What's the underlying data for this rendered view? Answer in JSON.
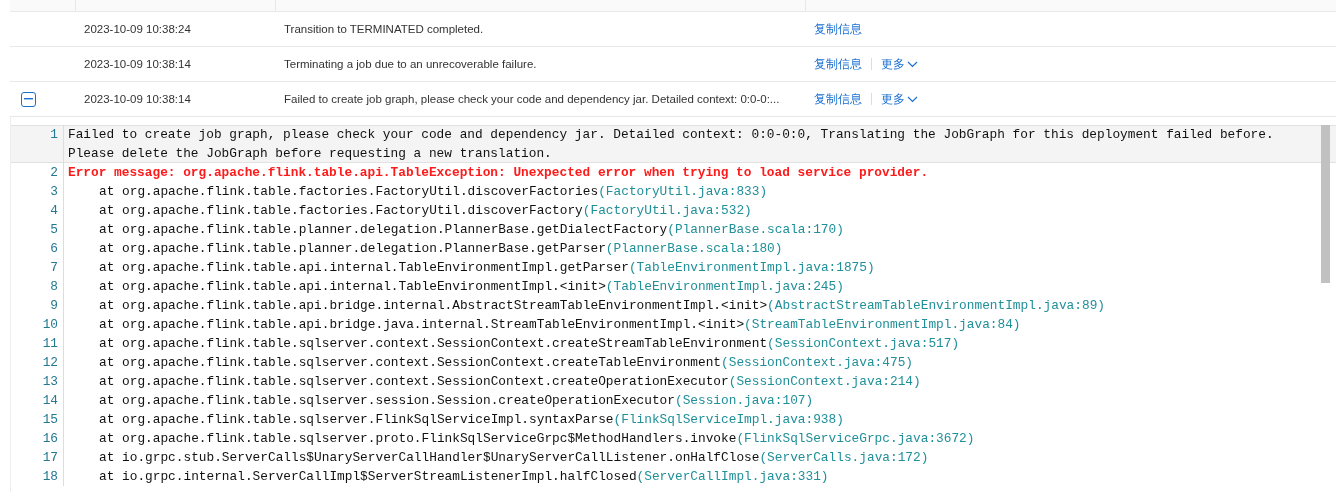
{
  "rows": [
    {
      "time": "2023-10-09 10:38:24",
      "message": "Transition to TERMINATED completed.",
      "expanded": false,
      "actions": [
        {
          "kind": "link",
          "label": "复制信息"
        }
      ]
    },
    {
      "time": "2023-10-09 10:38:14",
      "message": "Terminating a job due to an unrecoverable failure.",
      "expanded": false,
      "actions": [
        {
          "kind": "link",
          "label": "复制信息"
        },
        {
          "kind": "dropdown",
          "label": "更多"
        }
      ]
    },
    {
      "time": "2023-10-09 10:38:14",
      "message": "Failed to create job graph, please check your code and dependency jar. Detailed context: 0:0-0:...",
      "expanded": true,
      "actions": [
        {
          "kind": "link",
          "label": "复制信息"
        },
        {
          "kind": "dropdown",
          "label": "更多"
        }
      ]
    }
  ],
  "detail": {
    "lines": [
      {
        "number": "1",
        "kind": "plain",
        "text": "Failed to create job graph, please check your code and dependency jar. Detailed context: 0:0-0:0, Translating the JobGraph for this deployment failed before. Please delete the JobGraph before requesting a new translation.",
        "selected": true
      },
      {
        "number": "2",
        "kind": "error",
        "text": "Error message: org.apache.flink.table.api.TableException: Unexpected error when trying to load service provider.",
        "selected": false
      },
      {
        "number": "3",
        "kind": "frame",
        "text": "at org.apache.flink.table.factories.FactoryUtil.discoverFactories",
        "source": "(FactoryUtil.java:833)",
        "selected": false
      },
      {
        "number": "4",
        "kind": "frame",
        "text": "at org.apache.flink.table.factories.FactoryUtil.discoverFactory",
        "source": "(FactoryUtil.java:532)",
        "selected": false
      },
      {
        "number": "5",
        "kind": "frame",
        "text": "at org.apache.flink.table.planner.delegation.PlannerBase.getDialectFactory",
        "source": "(PlannerBase.scala:170)",
        "selected": false
      },
      {
        "number": "6",
        "kind": "frame",
        "text": "at org.apache.flink.table.planner.delegation.PlannerBase.getParser",
        "source": "(PlannerBase.scala:180)",
        "selected": false
      },
      {
        "number": "7",
        "kind": "frame",
        "text": "at org.apache.flink.table.api.internal.TableEnvironmentImpl.getParser",
        "source": "(TableEnvironmentImpl.java:1875)",
        "selected": false
      },
      {
        "number": "8",
        "kind": "frame",
        "text": "at org.apache.flink.table.api.internal.TableEnvironmentImpl.<init>",
        "source": "(TableEnvironmentImpl.java:245)",
        "selected": false
      },
      {
        "number": "9",
        "kind": "frame",
        "text": "at org.apache.flink.table.api.bridge.internal.AbstractStreamTableEnvironmentImpl.<init>",
        "source": "(AbstractStreamTableEnvironmentImpl.java:89)",
        "selected": false
      },
      {
        "number": "10",
        "kind": "frame",
        "text": "at org.apache.flink.table.api.bridge.java.internal.StreamTableEnvironmentImpl.<init>",
        "source": "(StreamTableEnvironmentImpl.java:84)",
        "selected": false
      },
      {
        "number": "11",
        "kind": "frame",
        "text": "at org.apache.flink.table.sqlserver.context.SessionContext.createStreamTableEnvironment",
        "source": "(SessionContext.java:517)",
        "selected": false
      },
      {
        "number": "12",
        "kind": "frame",
        "text": "at org.apache.flink.table.sqlserver.context.SessionContext.createTableEnvironment",
        "source": "(SessionContext.java:475)",
        "selected": false
      },
      {
        "number": "13",
        "kind": "frame",
        "text": "at org.apache.flink.table.sqlserver.context.SessionContext.createOperationExecutor",
        "source": "(SessionContext.java:214)",
        "selected": false
      },
      {
        "number": "14",
        "kind": "frame",
        "text": "at org.apache.flink.table.sqlserver.session.Session.createOperationExecutor",
        "source": "(Session.java:107)",
        "selected": false
      },
      {
        "number": "15",
        "kind": "frame",
        "text": "at org.apache.flink.table.sqlserver.FlinkSqlServiceImpl.syntaxParse",
        "source": "(FlinkSqlServiceImpl.java:938)",
        "selected": false
      },
      {
        "number": "16",
        "kind": "frame",
        "text": "at org.apache.flink.table.sqlserver.proto.FlinkSqlServiceGrpc$MethodHandlers.invoke",
        "source": "(FlinkSqlServiceGrpc.java:3672)",
        "selected": false
      },
      {
        "number": "17",
        "kind": "frame",
        "text": "at io.grpc.stub.ServerCalls$UnaryServerCallHandler$UnaryServerCallListener.onHalfClose",
        "source": "(ServerCalls.java:172)",
        "selected": false
      },
      {
        "number": "18",
        "kind": "frame",
        "text": "at io.grpc.internal.ServerCallImpl$ServerStreamListenerImpl.halfClosed",
        "source": "(ServerCallImpl.java:331)",
        "selected": false
      }
    ]
  }
}
